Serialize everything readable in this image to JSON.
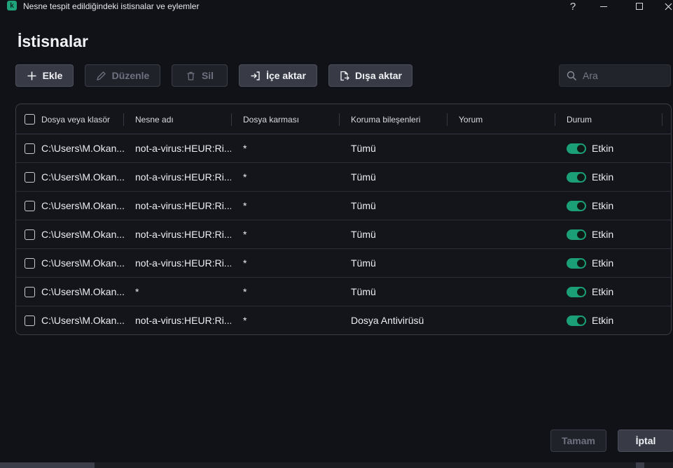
{
  "window": {
    "title": "Nesne tespit edildiğindeki istisnalar ve eylemler",
    "app_icon_letter": "k",
    "help": "?"
  },
  "page": {
    "title": "İstisnalar"
  },
  "toolbar": {
    "add": "Ekle",
    "edit": "Düzenle",
    "delete": "Sil",
    "import": "İçe aktar",
    "export": "Dışa aktar"
  },
  "search": {
    "placeholder": "Ara",
    "value": ""
  },
  "table": {
    "headers": {
      "file": "Dosya veya klasör",
      "object": "Nesne adı",
      "hash": "Dosya karması",
      "components": "Koruma bileşenleri",
      "comment": "Yorum",
      "status": "Durum"
    },
    "rows": [
      {
        "file": "C:\\Users\\M.Okan...",
        "object": "not-a-virus:HEUR:Ri...",
        "hash": "*",
        "components": "Tümü",
        "comment": "",
        "status": "Etkin",
        "enabled": true
      },
      {
        "file": "C:\\Users\\M.Okan...",
        "object": "not-a-virus:HEUR:Ri...",
        "hash": "*",
        "components": "Tümü",
        "comment": "",
        "status": "Etkin",
        "enabled": true
      },
      {
        "file": "C:\\Users\\M.Okan...",
        "object": "not-a-virus:HEUR:Ri...",
        "hash": "*",
        "components": "Tümü",
        "comment": "",
        "status": "Etkin",
        "enabled": true
      },
      {
        "file": "C:\\Users\\M.Okan...",
        "object": "not-a-virus:HEUR:Ri...",
        "hash": "*",
        "components": "Tümü",
        "comment": "",
        "status": "Etkin",
        "enabled": true
      },
      {
        "file": "C:\\Users\\M.Okan...",
        "object": "not-a-virus:HEUR:Ri...",
        "hash": "*",
        "components": "Tümü",
        "comment": "",
        "status": "Etkin",
        "enabled": true
      },
      {
        "file": "C:\\Users\\M.Okan...",
        "object": "*",
        "hash": "*",
        "components": "Tümü",
        "comment": "",
        "status": "Etkin",
        "enabled": true
      },
      {
        "file": "C:\\Users\\M.Okan...",
        "object": "not-a-virus:HEUR:Ri...",
        "hash": "*",
        "components": "Dosya Antivirüsü",
        "comment": "",
        "status": "Etkin",
        "enabled": true
      }
    ]
  },
  "footer": {
    "ok": "Tamam",
    "cancel": "İptal"
  },
  "colors": {
    "accent": "#1a9f76",
    "background": "#111218"
  },
  "icons": {
    "add": "plus-icon",
    "edit": "pencil-icon",
    "delete": "trash-icon",
    "import": "import-icon",
    "export": "export-icon",
    "search": "search-icon"
  }
}
